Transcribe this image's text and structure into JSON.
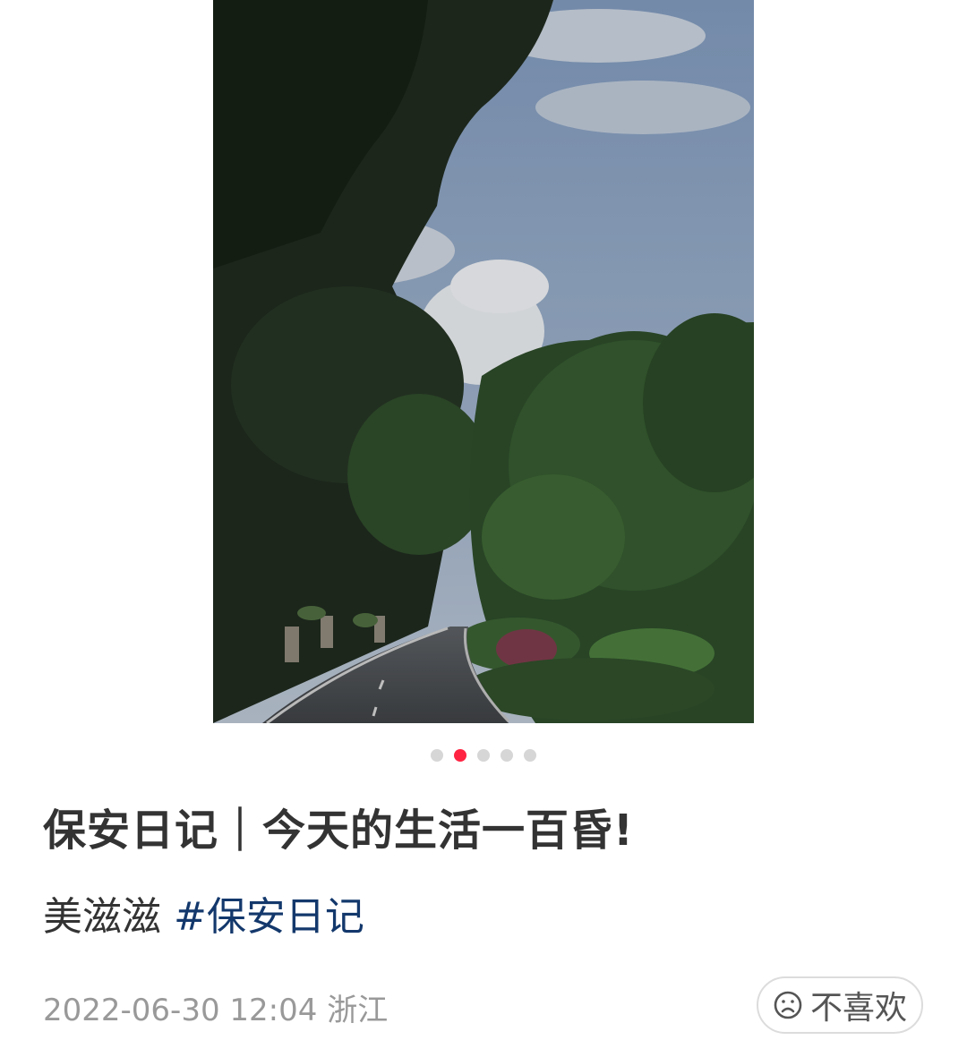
{
  "carousel": {
    "count": 5,
    "active_index": 1
  },
  "post": {
    "title": "保安日记｜今天的生活一百昏!",
    "body_text": "美滋滋",
    "hashtag": "#保安日记",
    "date": "2022-06-30 12:04",
    "location": "浙江"
  },
  "actions": {
    "dislike_label": "不喜欢",
    "dislike_icon": "frown-face-icon"
  },
  "colors": {
    "accent": "#ff2442",
    "hashtag": "#13386c",
    "meta": "#999999"
  }
}
